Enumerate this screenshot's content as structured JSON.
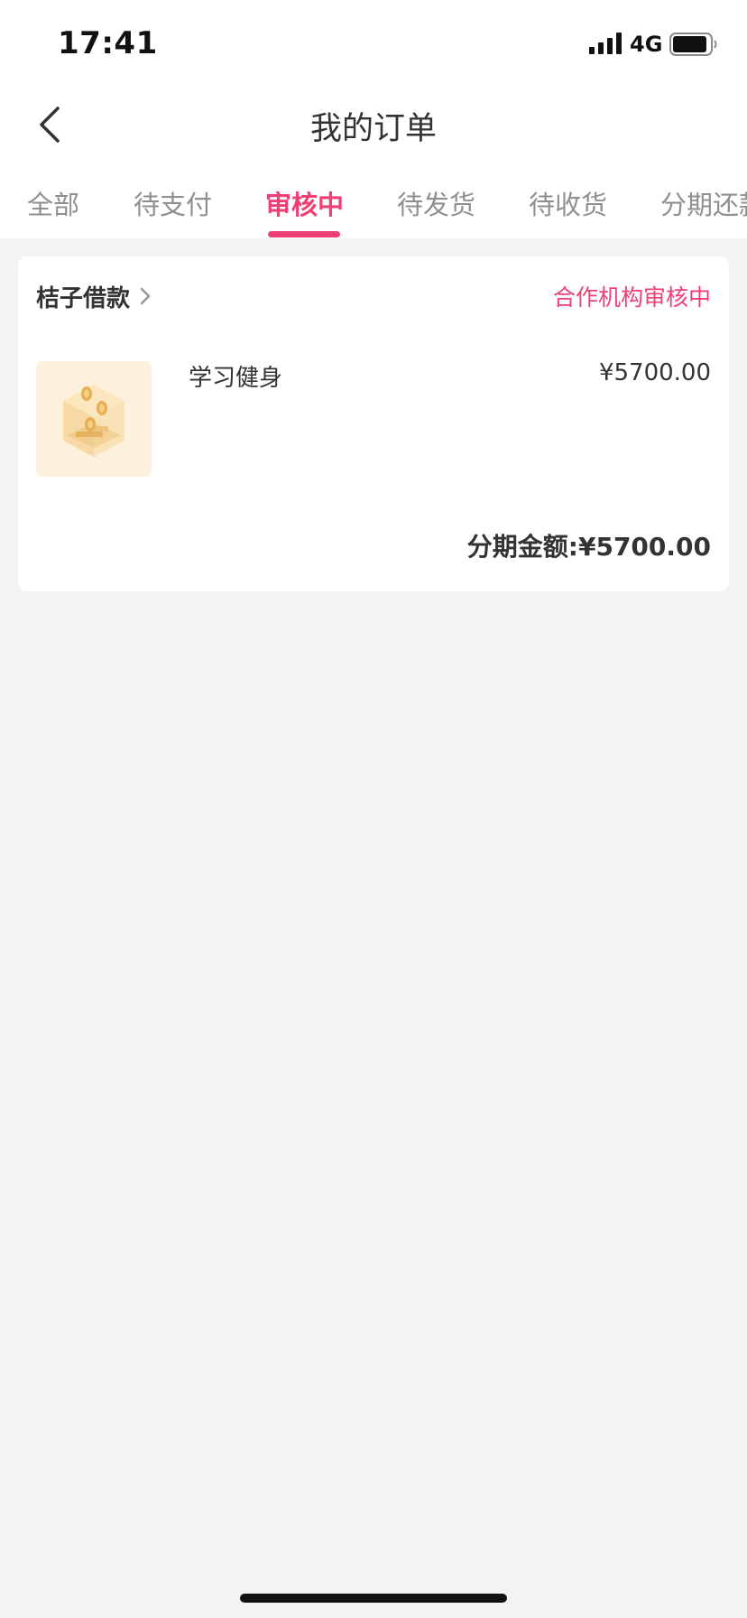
{
  "status_bar": {
    "time": "17:41",
    "network": "4G"
  },
  "header": {
    "title": "我的订单"
  },
  "tabs": [
    {
      "label": "全部",
      "active": false
    },
    {
      "label": "待支付",
      "active": false
    },
    {
      "label": "审核中",
      "active": true
    },
    {
      "label": "待发货",
      "active": false
    },
    {
      "label": "待收货",
      "active": false
    },
    {
      "label": "分期还款",
      "active": false
    }
  ],
  "order": {
    "merchant": "桔子借款",
    "status": "合作机构审核中",
    "product_name": "学习健身",
    "price": "¥5700.00",
    "installment_amount": "分期金额:¥5700.00"
  },
  "colors": {
    "accent": "#ef4076",
    "background": "#f3f3f3",
    "card": "#ffffff",
    "thumbnail_bg": "#fdf1de"
  },
  "icons": {
    "back": "back-arrow-icon",
    "merchant_link": "chevron-right-icon",
    "signal": "cellular-signal-icon",
    "battery": "battery-icon",
    "product": "coin-box-illustration"
  }
}
